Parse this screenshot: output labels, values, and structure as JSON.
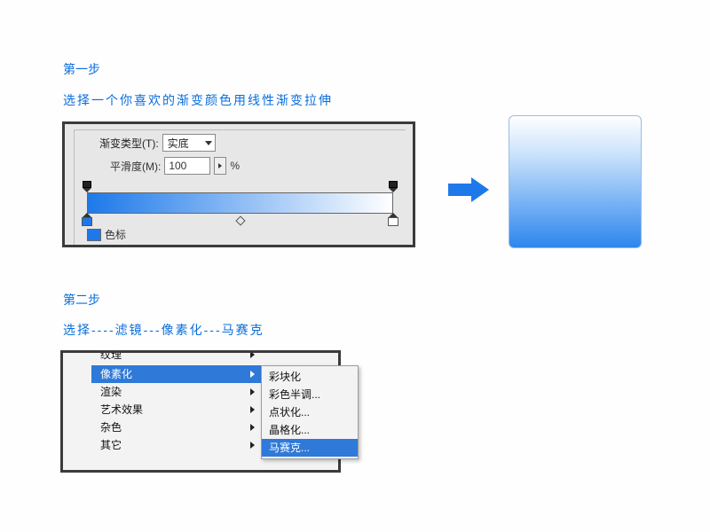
{
  "step1": {
    "title": "第一步",
    "subtitle": "选择一个你喜欢的渐变颜色用线性渐变拉伸"
  },
  "panel": {
    "type_label": "渐变类型(T):",
    "type_value": "实底",
    "smooth_label": "平滑度(M):",
    "smooth_value": "100",
    "smooth_unit": "%",
    "color_stop_label": "色标"
  },
  "step2": {
    "title": "第二步",
    "subtitle": "选择----滤镜---像素化---马赛克"
  },
  "menu": {
    "items": [
      {
        "label": "纹理",
        "arrow": true,
        "cut": true,
        "selected": false
      },
      {
        "label": "像素化",
        "arrow": true,
        "selected": true
      },
      {
        "label": "渲染",
        "arrow": true,
        "selected": false
      },
      {
        "label": "艺术效果",
        "arrow": true,
        "selected": false
      },
      {
        "label": "杂色",
        "arrow": true,
        "selected": false
      },
      {
        "label": "其它",
        "arrow": true,
        "selected": false
      }
    ]
  },
  "submenu": {
    "items": [
      {
        "label": "彩块化",
        "selected": false
      },
      {
        "label": "彩色半调...",
        "selected": false
      },
      {
        "label": "点状化...",
        "selected": false
      },
      {
        "label": "晶格化...",
        "selected": false
      },
      {
        "label": "马赛克...",
        "selected": true
      }
    ]
  }
}
